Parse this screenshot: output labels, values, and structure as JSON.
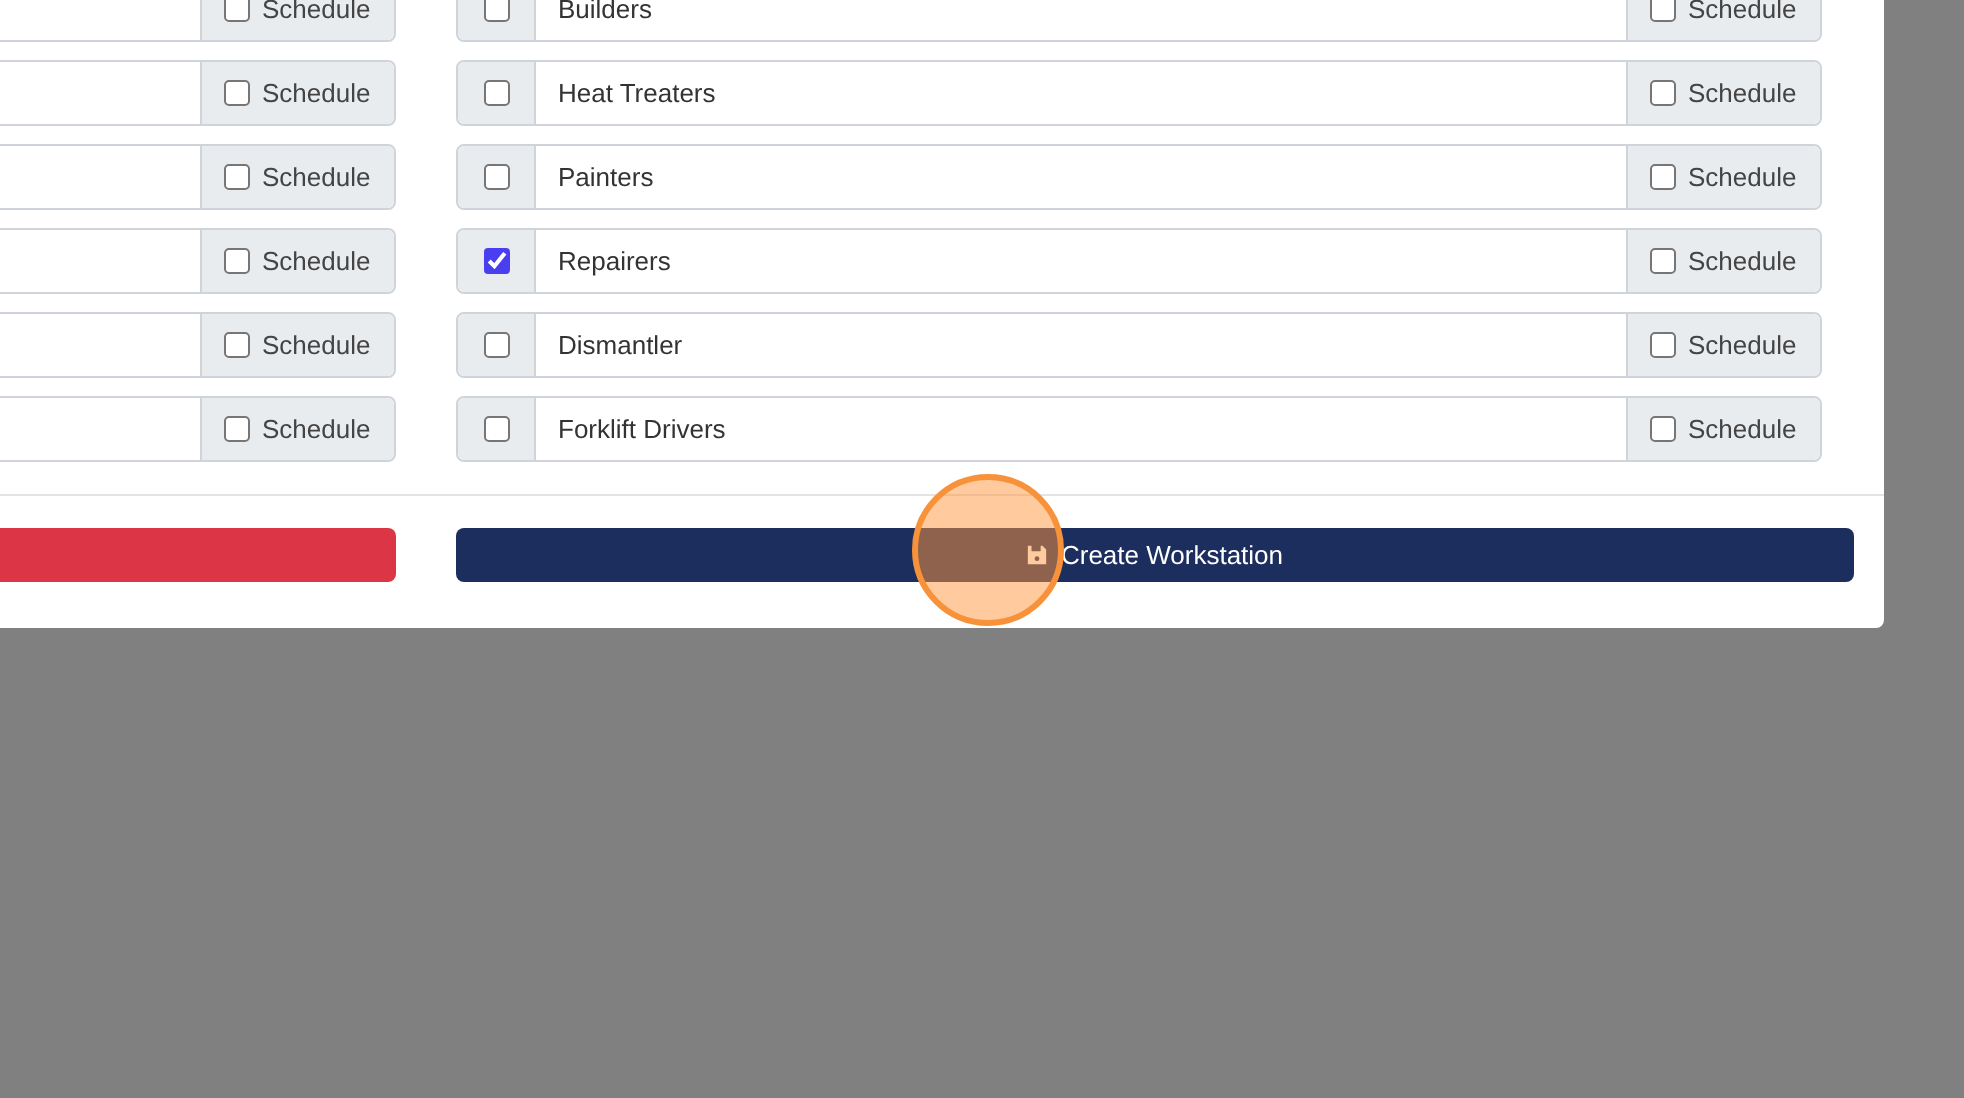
{
  "left_rows": [
    {
      "schedule": {
        "label": "Schedule",
        "checked": false
      }
    },
    {
      "schedule": {
        "label": "Schedule",
        "checked": false
      }
    },
    {
      "schedule": {
        "label": "Schedule",
        "checked": false
      }
    },
    {
      "schedule": {
        "label": "Schedule",
        "checked": false
      }
    },
    {
      "schedule": {
        "label": "Schedule",
        "checked": false
      }
    },
    {
      "schedule": {
        "label": "Schedule",
        "checked": false
      }
    }
  ],
  "right_rows": [
    {
      "label": "Builders",
      "checked": false,
      "schedule": {
        "label": "Schedule",
        "checked": false
      }
    },
    {
      "label": "Heat Treaters",
      "checked": false,
      "schedule": {
        "label": "Schedule",
        "checked": false
      }
    },
    {
      "label": "Painters",
      "checked": false,
      "schedule": {
        "label": "Schedule",
        "checked": false
      }
    },
    {
      "label": "Repairers",
      "checked": true,
      "schedule": {
        "label": "Schedule",
        "checked": false
      }
    },
    {
      "label": "Dismantler",
      "checked": false,
      "schedule": {
        "label": "Schedule",
        "checked": false
      }
    },
    {
      "label": "Forklift Drivers",
      "checked": false,
      "schedule": {
        "label": "Schedule",
        "checked": false
      }
    }
  ],
  "buttons": [
    {
      "kind": "danger"
    },
    {
      "kind": "primary",
      "label": "Create Workstation"
    }
  ]
}
